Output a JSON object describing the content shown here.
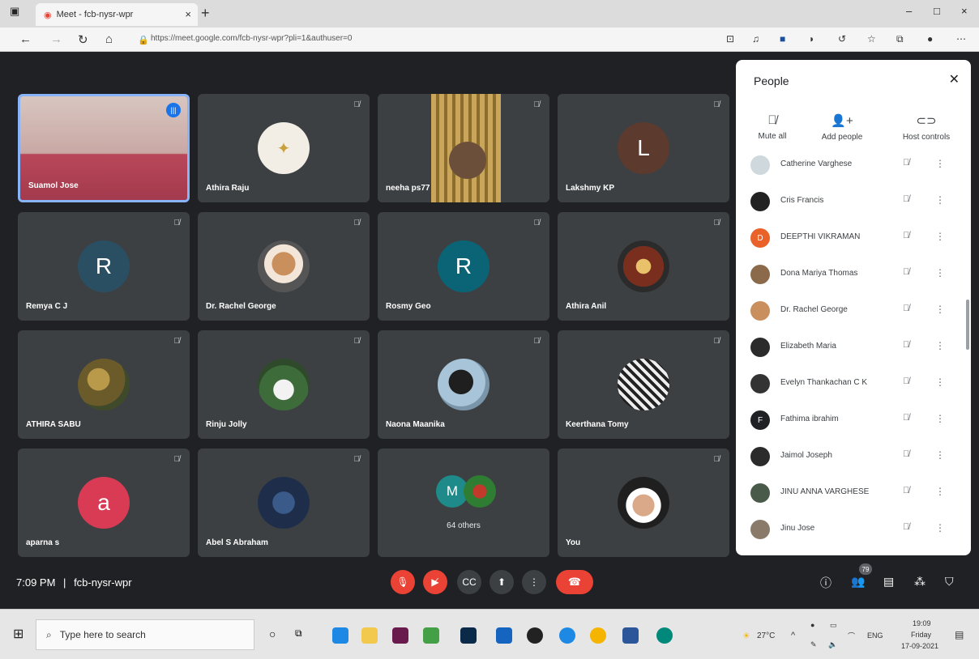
{
  "browser": {
    "tab_title": "Meet - fcb-nysr-wpr",
    "tab_close": "×",
    "new_tab": "+",
    "url": "https://meet.google.com/fcb-nysr-wpr?pli=1&authuser=0",
    "window_controls": [
      "–",
      "□",
      "×"
    ]
  },
  "tiles": [
    {
      "name": "Suamol Jose",
      "kind": "video1",
      "speaking": true
    },
    {
      "name": "Athira Raju",
      "kind": "photo"
    },
    {
      "name": "neeha ps77",
      "kind": "video2"
    },
    {
      "name": "Lakshmy KP",
      "kind": "letter",
      "letter": "L",
      "color": "#5d3a2e"
    },
    {
      "name": "Remya C J",
      "kind": "letter",
      "letter": "R",
      "color": "#2a4f63"
    },
    {
      "name": "Dr. Rachel George",
      "kind": "photo"
    },
    {
      "name": "Rosmy Geo",
      "kind": "letter",
      "letter": "R",
      "color": "#0b6475"
    },
    {
      "name": "Athira Anil",
      "kind": "photo"
    },
    {
      "name": "ATHIRA SABU",
      "kind": "photo"
    },
    {
      "name": "Rinju Jolly",
      "kind": "photo"
    },
    {
      "name": "Naona Maanika",
      "kind": "photo"
    },
    {
      "name": "Keerthana Tomy",
      "kind": "photo"
    },
    {
      "name": "aparna s",
      "kind": "letter",
      "letter": "a",
      "color": "#d93a54"
    },
    {
      "name": "Abel S Abraham",
      "kind": "photo"
    },
    {
      "name": "64 others",
      "kind": "others",
      "letter": "M",
      "color": "#1e8a8a"
    },
    {
      "name": "You",
      "kind": "photo"
    }
  ],
  "meeting": {
    "time": "7:09 PM",
    "code": "fcb-nysr-wpr",
    "participant_count": "79"
  },
  "people_panel": {
    "title": "People",
    "actions": [
      {
        "label": "Mute all"
      },
      {
        "label": "Add people"
      },
      {
        "label": "Host controls"
      }
    ],
    "participants": [
      "Catherine Varghese",
      "Cris Francis",
      "DEEPTHI VIKRAMAN",
      "Dona Mariya Thomas",
      "Dr. Rachel George",
      "Elizabeth Maria",
      "Evelyn Thankachan C K",
      "Fathima ibrahim",
      "Jaimol Joseph",
      "JINU ANNA VARGHESE",
      "Jinu Jose"
    ],
    "avatar_letters": {
      "DEEPTHI VIKRAMAN": "D",
      "Fathima ibrahim": "F"
    }
  },
  "taskbar": {
    "search_placeholder": "Type here to search",
    "weather": "27°C",
    "language": "ENG",
    "clock_time": "19:09",
    "clock_day": "Friday",
    "clock_date": "17-09-2021"
  }
}
